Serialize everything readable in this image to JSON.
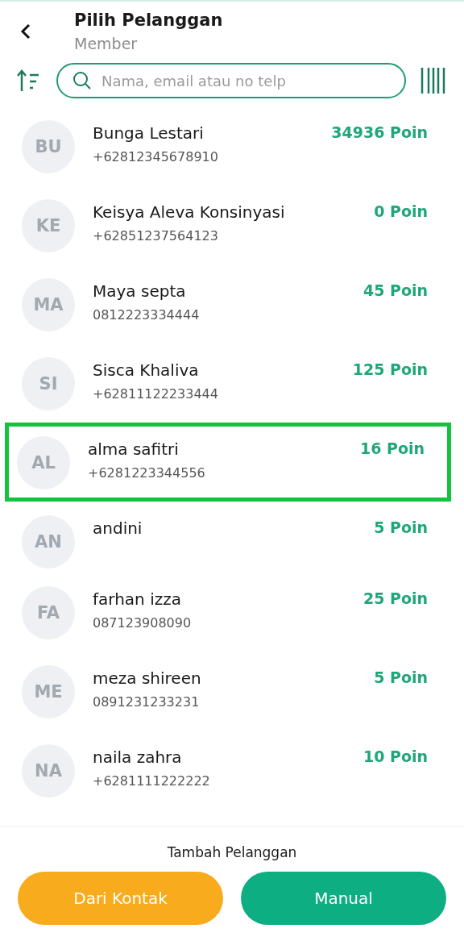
{
  "header": {
    "title": "Pilih Pelanggan",
    "subtitle": "Member"
  },
  "search": {
    "placeholder": "Nama, email atau no telp"
  },
  "customers": [
    {
      "initials": "BU",
      "name": "Bunga Lestari",
      "phone": "+62812345678910",
      "points": "34936 Poin",
      "selected": false
    },
    {
      "initials": "KE",
      "name": "Keisya Aleva Konsinyasi",
      "phone": "+62851237564123",
      "points": "0 Poin",
      "selected": false
    },
    {
      "initials": "MA",
      "name": "Maya septa",
      "phone": "0812223334444",
      "points": "45 Poin",
      "selected": false
    },
    {
      "initials": "SI",
      "name": "Sisca Khaliva",
      "phone": "+62811122233444",
      "points": "125 Poin",
      "selected": false
    },
    {
      "initials": "AL",
      "name": "alma safitri",
      "phone": "+6281223344556",
      "points": "16 Poin",
      "selected": true
    },
    {
      "initials": "AN",
      "name": "andini",
      "points": "5 Poin",
      "selected": false
    },
    {
      "initials": "FA",
      "name": "farhan izza",
      "phone": "087123908090",
      "points": "25 Poin",
      "selected": false
    },
    {
      "initials": "ME",
      "name": "meza shireen",
      "phone": "0891231233231",
      "points": "5 Poin",
      "selected": false
    },
    {
      "initials": "NA",
      "name": "naila zahra",
      "phone": "+6281111222222",
      "points": "10 Poin",
      "selected": false
    }
  ],
  "footer": {
    "label": "Tambah Pelanggan",
    "buttons": [
      {
        "label": "Dari Kontak",
        "kind": "contacts"
      },
      {
        "label": "Manual",
        "kind": "manual"
      }
    ]
  }
}
